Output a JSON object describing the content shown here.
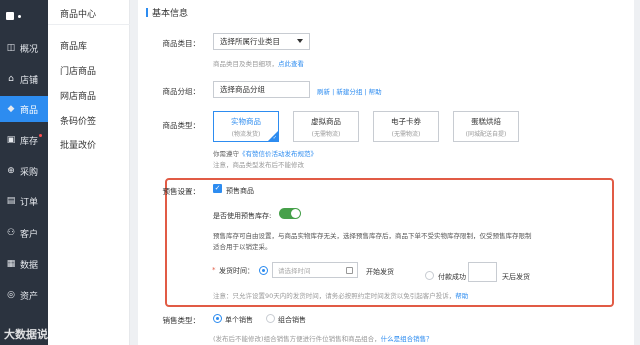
{
  "sidebar": {
    "items": [
      {
        "icon": "chart-icon",
        "glyph": "◫",
        "label": "概况"
      },
      {
        "icon": "store-icon",
        "glyph": "⌂",
        "label": "店铺"
      },
      {
        "icon": "tag-icon",
        "glyph": "◆",
        "label": "商品"
      },
      {
        "icon": "box-icon",
        "glyph": "▣",
        "label": "库存"
      },
      {
        "icon": "purchase-icon",
        "glyph": "⊕",
        "label": "采购"
      },
      {
        "icon": "order-icon",
        "glyph": "▤",
        "label": "订单"
      },
      {
        "icon": "customer-icon",
        "glyph": "⚇",
        "label": "客户"
      },
      {
        "icon": "data-icon",
        "glyph": "▦",
        "label": "数据"
      },
      {
        "icon": "asset-icon",
        "glyph": "◎",
        "label": "资产"
      }
    ]
  },
  "subnav": {
    "title": "商品中心",
    "items": [
      "商品库",
      "门店商品",
      "网店商品",
      "条码价签",
      "批量改价"
    ]
  },
  "section": {
    "title": "基本信息"
  },
  "category": {
    "label": "商品类目：",
    "value": "选择所属行业类目",
    "hint": "商品类目及类目细项，",
    "hint_link": "点此查看"
  },
  "group": {
    "label": "商品分组：",
    "value": "选择商品分组",
    "links": "刷新 | 新建分组 | 帮助"
  },
  "type": {
    "label": "商品类型：",
    "cards": [
      {
        "title": "实物商品",
        "sub": "(物流发货)"
      },
      {
        "title": "虚拟商品",
        "sub": "(无需物流)"
      },
      {
        "title": "电子卡券",
        "sub": "(无需物流)"
      },
      {
        "title": "蛋糕烘焙",
        "sub": "(同城配送自提)"
      }
    ],
    "note1_prefix": "你需遵守",
    "note1_link": "《有赞信价活动发布规范》",
    "note2": "注意，商品类型发布后不能修改"
  },
  "presale": {
    "label": "预售设置：",
    "checkbox_label": "预售商品",
    "stock_label": "是否使用预售库存:",
    "desc1": "预售库存可自由设置，与商品实物库存无关，选择预售库存后，商品下单不受实物库存限制，仅受预售库存限制",
    "desc2": "适合用于以销定采。",
    "ship_label": "发货时间：",
    "date_placeholder": "请选择时间",
    "ship_after": "开始发货",
    "pay_prefix": "付款成功",
    "pay_suffix": "天后发货",
    "note": "注意：只允许设置90天内的发货时间，请务必按照约定时间发货以免引起客户投诉，",
    "note_link": "帮助"
  },
  "sales": {
    "label": "销售类型：",
    "option1": "单个销售",
    "option2": "组合销售",
    "note": "(发布后不能修改)组合销售方便进行件位销售和商品组合，",
    "note_link": "什么是组合销售？"
  },
  "watermark": "大数据说"
}
